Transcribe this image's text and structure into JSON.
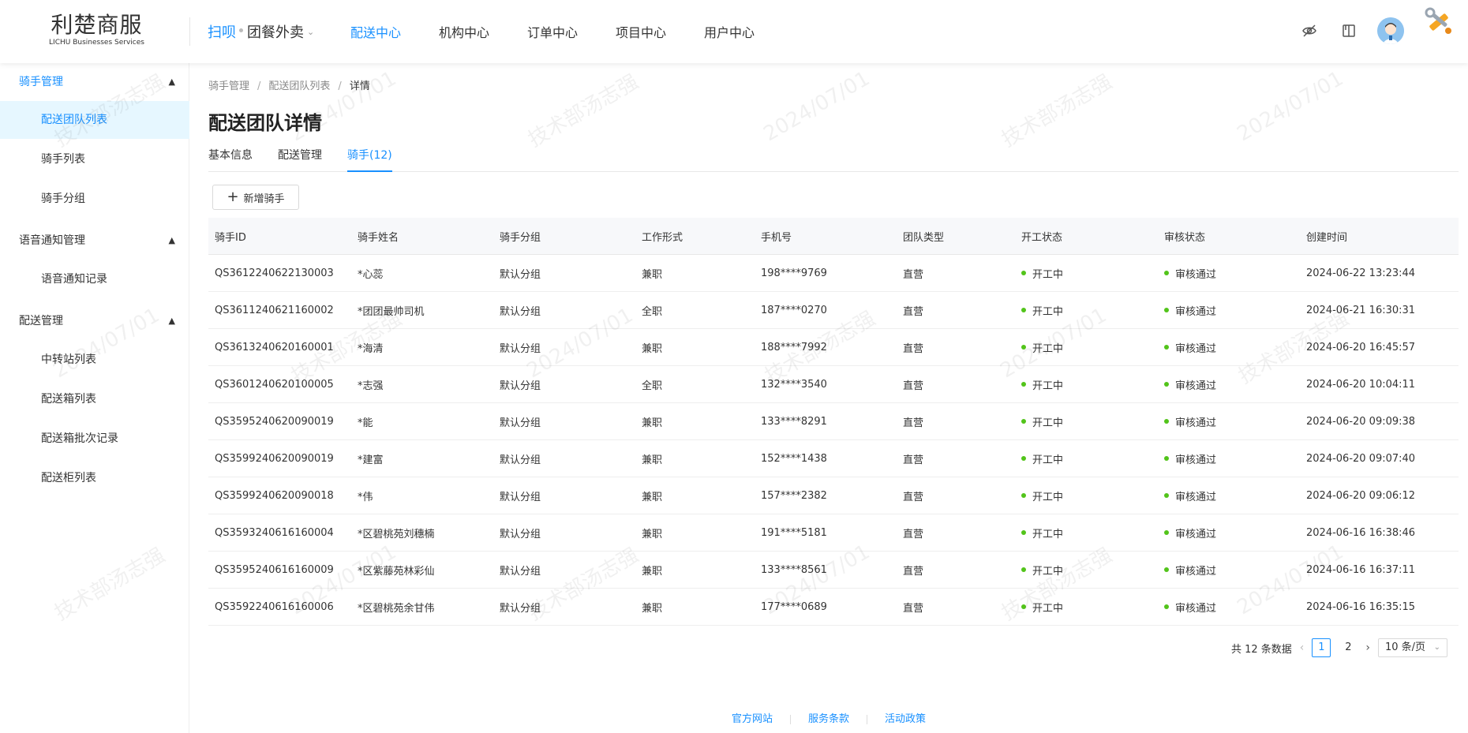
{
  "logo": {
    "cn": "利楚商服",
    "en": "LICHU Businesses Services"
  },
  "header": {
    "scan_label": "扫呗",
    "business_select": "团餐外卖",
    "nav": [
      {
        "label": "配送中心",
        "active": true
      },
      {
        "label": "机构中心",
        "active": false
      },
      {
        "label": "订单中心",
        "active": false
      },
      {
        "label": "项目中心",
        "active": false
      },
      {
        "label": "用户中心",
        "active": false
      }
    ]
  },
  "sidebar": {
    "groups": [
      {
        "title": "骑手管理",
        "items": [
          "配送团队列表",
          "骑手列表",
          "骑手分组"
        ]
      },
      {
        "title": "语音通知管理",
        "items": [
          "语音通知记录"
        ]
      },
      {
        "title": "配送管理",
        "items": [
          "中转站列表",
          "配送箱列表",
          "配送箱批次记录",
          "配送柜列表"
        ]
      }
    ],
    "selected": "配送团队列表"
  },
  "breadcrumb": {
    "items": [
      "骑手管理",
      "配送团队列表"
    ],
    "current": "详情",
    "sep": "/"
  },
  "page_title": "配送团队详情",
  "tabs": [
    {
      "label": "基本信息",
      "active": false
    },
    {
      "label": "配送管理",
      "active": false
    },
    {
      "label": "骑手(12)",
      "active": true
    }
  ],
  "add_button": {
    "label": "新增骑手"
  },
  "table": {
    "headers": [
      "骑手ID",
      "骑手姓名",
      "骑手分组",
      "工作形式",
      "手机号",
      "团队类型",
      "开工状态",
      "审核状态",
      "创建时间"
    ],
    "rows": [
      [
        "QS3612240622130003",
        "*心蕊",
        "默认分组",
        "兼职",
        "198****9769",
        "直营",
        "开工中",
        "审核通过",
        "2024-06-22 13:23:44"
      ],
      [
        "QS3611240621160002",
        "*团团最帅司机",
        "默认分组",
        "全职",
        "187****0270",
        "直营",
        "开工中",
        "审核通过",
        "2024-06-21 16:30:31"
      ],
      [
        "QS3613240620160001",
        "*海清",
        "默认分组",
        "兼职",
        "188****7992",
        "直营",
        "开工中",
        "审核通过",
        "2024-06-20 16:45:57"
      ],
      [
        "QS3601240620100005",
        "*志强",
        "默认分组",
        "全职",
        "132****3540",
        "直营",
        "开工中",
        "审核通过",
        "2024-06-20 10:04:11"
      ],
      [
        "QS3595240620090019",
        "*能",
        "默认分组",
        "兼职",
        "133****8291",
        "直营",
        "开工中",
        "审核通过",
        "2024-06-20 09:09:38"
      ],
      [
        "QS3599240620090019",
        "*建富",
        "默认分组",
        "兼职",
        "152****1438",
        "直营",
        "开工中",
        "审核通过",
        "2024-06-20 09:07:40"
      ],
      [
        "QS3599240620090018",
        "*伟",
        "默认分组",
        "兼职",
        "157****2382",
        "直营",
        "开工中",
        "审核通过",
        "2024-06-20 09:06:12"
      ],
      [
        "QS3593240616160004",
        "*区碧桃苑刘穗楠",
        "默认分组",
        "兼职",
        "191****5181",
        "直营",
        "开工中",
        "审核通过",
        "2024-06-16 16:38:46"
      ],
      [
        "QS3595240616160009",
        "*区紫藤苑林彩仙",
        "默认分组",
        "兼职",
        "133****8561",
        "直营",
        "开工中",
        "审核通过",
        "2024-06-16 16:37:11"
      ],
      [
        "QS3592240616160006",
        "*区碧桃苑余甘伟",
        "默认分组",
        "兼职",
        "177****0689",
        "直营",
        "开工中",
        "审核通过",
        "2024-06-16 16:35:15"
      ]
    ]
  },
  "pagination": {
    "total_text": "共 12 条数据",
    "pages": [
      "1",
      "2"
    ],
    "current": "1",
    "page_size": "10 条/页"
  },
  "footer": {
    "links": [
      "官方网站",
      "服务条款",
      "活动政策"
    ]
  },
  "watermark": {
    "name": "技术部汤志强",
    "date": "2024/07/01"
  },
  "colors": {
    "accent": "#1890ff",
    "status_green": "#52c41a"
  },
  "icons": [
    "eye-slash-icon",
    "book-icon",
    "user-avatar-icon",
    "tools-icon",
    "plus-icon",
    "chevron-down-icon",
    "chevron-up-icon"
  ]
}
